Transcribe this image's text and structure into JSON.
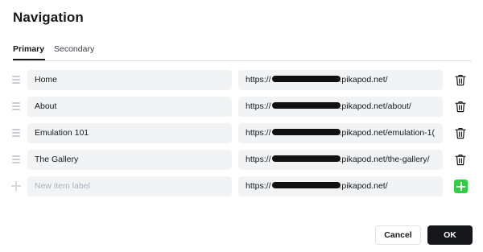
{
  "modal": {
    "title": "Navigation"
  },
  "tabs": [
    {
      "label": "Primary",
      "active": true
    },
    {
      "label": "Secondary",
      "active": false
    }
  ],
  "items": [
    {
      "label": "Home",
      "url_prefix": "https://",
      "url_suffix": ".pikapod.net/"
    },
    {
      "label": "About",
      "url_prefix": "https://",
      "url_suffix": ".pikapod.net/about/"
    },
    {
      "label": "Emulation 101",
      "url_prefix": "https://",
      "url_suffix": ".pikapod.net/emulation-1("
    },
    {
      "label": "The Gallery",
      "url_prefix": "https://",
      "url_suffix": ".pikapod.net/the-gallery/"
    }
  ],
  "new_item": {
    "label_placeholder": "New item label",
    "url_prefix": "https://",
    "url_suffix": ".pikapod.net/"
  },
  "buttons": {
    "cancel": "Cancel",
    "ok": "OK"
  },
  "colors": {
    "accent_green": "#30cf43",
    "primary_button": "#15171a",
    "field_background": "#f1f3f4"
  },
  "icons": {
    "drag": "drag-handle-icon",
    "delete": "trash-icon",
    "add": "plus-icon"
  }
}
